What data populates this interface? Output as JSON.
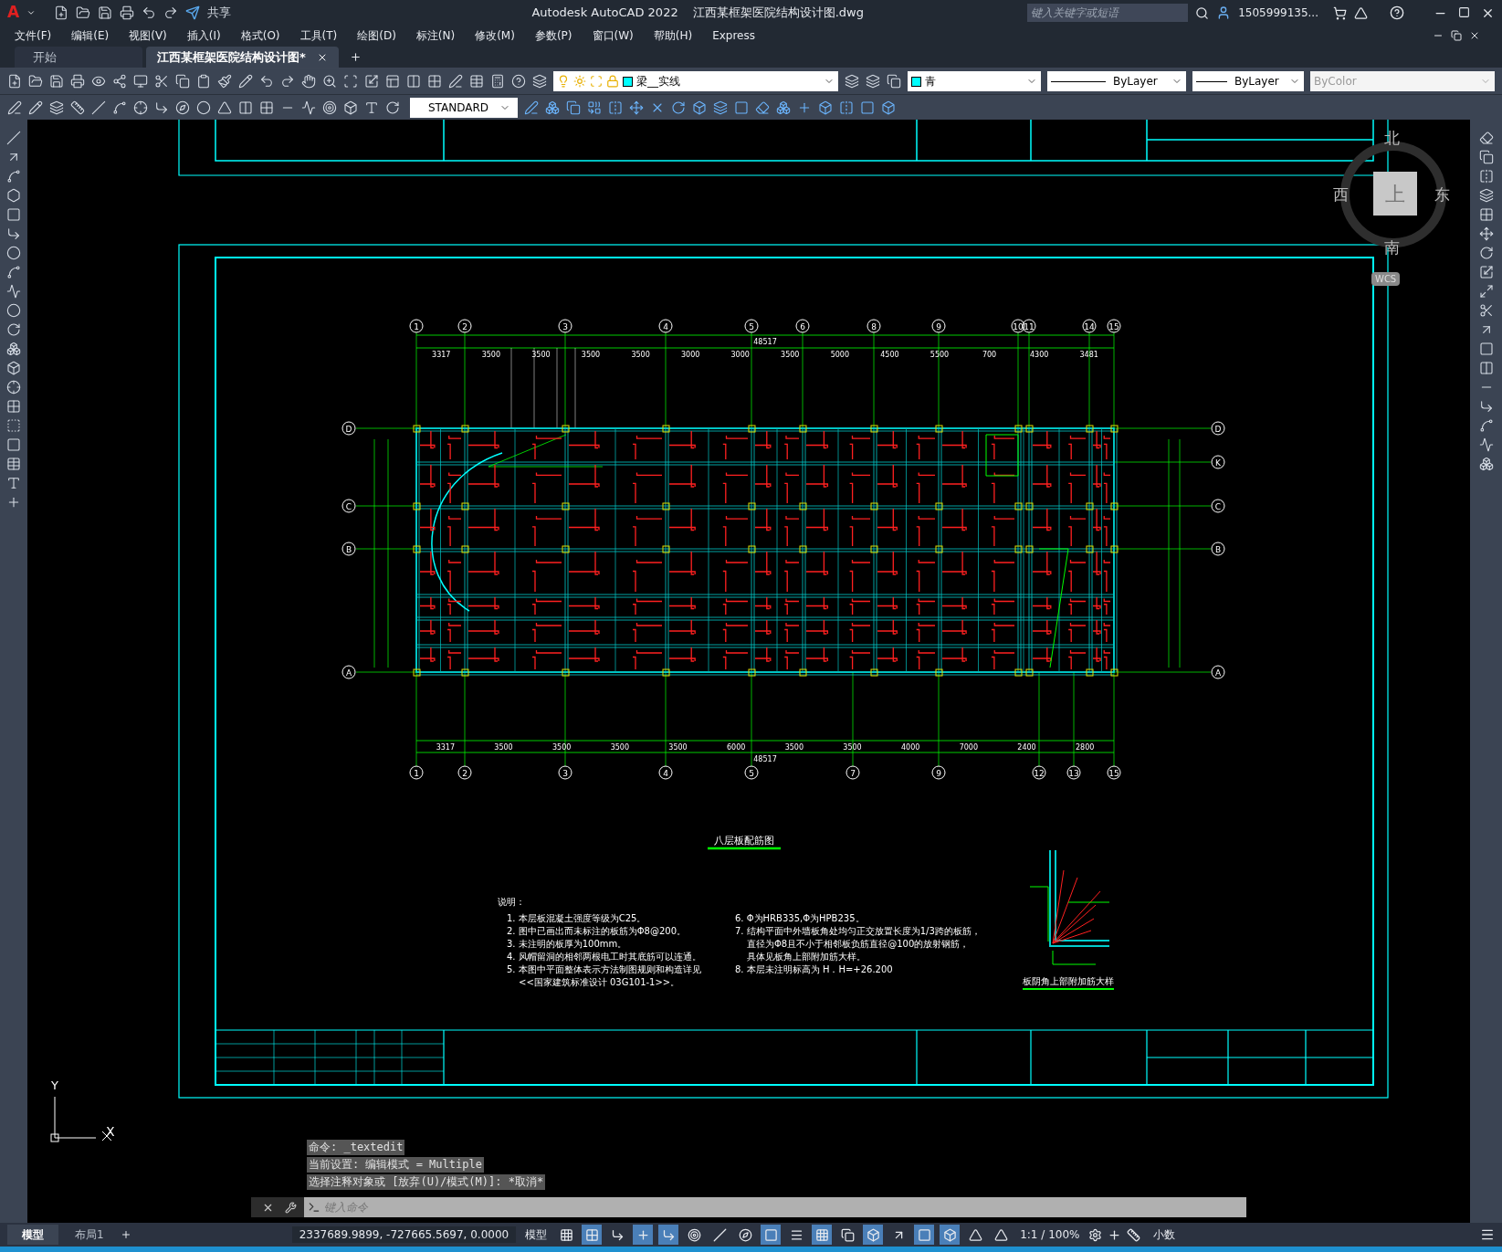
{
  "title_bar": {
    "logo": "A",
    "share": "共享",
    "app_title": "Autodesk AutoCAD 2022",
    "file_name": "江西某框架医院结构设计图.dwg",
    "search_placeholder": "键入关键字或短语",
    "user": "1505999135..."
  },
  "menu": [
    "文件(F)",
    "编辑(E)",
    "视图(V)",
    "插入(I)",
    "格式(O)",
    "工具(T)",
    "绘图(D)",
    "标注(N)",
    "修改(M)",
    "参数(P)",
    "窗口(W)",
    "帮助(H)",
    "Express"
  ],
  "doc_tabs": [
    {
      "label": "开始",
      "selected": false
    },
    {
      "label": "江西某框架医院结构设计图*",
      "selected": true
    }
  ],
  "toolbar": {
    "layer": "梁__实线",
    "color_name": "青",
    "color": "#00ffff",
    "linetype": "ByLayer",
    "lineweight": "ByLayer",
    "plot_style": "ByColor",
    "text_style": "STANDARD"
  },
  "viewcube": {
    "north": "北",
    "west": "西",
    "east": "东",
    "south": "南",
    "face": "上",
    "wcs": "WCS"
  },
  "ucs": {
    "x": "X",
    "y": "Y"
  },
  "drawing": {
    "top_axes": [
      "1",
      "2",
      "3",
      "4",
      "5",
      "6",
      "8",
      "9",
      "10",
      "11",
      "14",
      "15"
    ],
    "bottom_axes": [
      "1",
      "2",
      "3",
      "4",
      "5",
      "7",
      "9",
      "12",
      "13",
      "15"
    ],
    "left_axes": [
      "D",
      "C",
      "B",
      "A"
    ],
    "right_axes": [
      "D",
      "K",
      "C",
      "B",
      "A"
    ],
    "top_total": "48517",
    "top_dims": [
      "3317",
      "3500",
      "3500",
      "3500",
      "3500",
      "3000",
      "3000",
      "3500",
      "5000",
      "4500",
      "5500",
      "700",
      "4300",
      "3481"
    ],
    "bottom_dims": [
      "3317",
      "3500",
      "3500",
      "3500",
      "3500",
      "6000",
      "3500",
      "3500",
      "4000",
      "7000",
      "2400",
      "2800"
    ],
    "bottom_total": "48517",
    "title": "八层板配筋图",
    "notes_heading": "说明：",
    "notes_col1": [
      "1. 本层板混凝土强度等级为C25。",
      "2. 图中已画出而未标注的板筋为Φ8@200。",
      "3. 未注明的板厚为100mm。",
      "4. 风帽留洞的相邻两根电工时其底筋可以连通。",
      "5. 本图中平面整体表示方法制图规则和构造详见",
      "<<国家建筑标准设计 03G101-1>>。"
    ],
    "notes_col2": [
      "6. Φ为HRB335,Φ为HPB235。",
      "7. 结构平面中外墙板角处均匀正交放置长度为1/3跨的板筋，",
      "直径为Φ8且不小于相邻板负筋直径@100的放射钢筋，",
      "具体见板角上部附加筋大样。",
      "8. 本层未注明标高为 H．H=+26.200"
    ],
    "detail_caption": "板阴角上部附加筋大样"
  },
  "command_history": [
    "命令: _textedit",
    "当前设置: 编辑模式 = Multiple",
    "选择注释对象或 [放弃(U)/模式(M)]: *取消*"
  ],
  "command_placeholder": "键入命令",
  "layout_tabs": [
    {
      "label": "模型",
      "selected": true
    },
    {
      "label": "布局1",
      "selected": false
    }
  ],
  "status_bar": {
    "coordinates": "2337689.9899, -727665.5697, 0.0000",
    "space": "模型",
    "scale": "1:1 / 100%",
    "units": "小数",
    "toggles": [
      {
        "on": false
      },
      {
        "on": true
      },
      {
        "on": false
      },
      {
        "on": true
      },
      {
        "on": true
      },
      {
        "on": false
      },
      {
        "on": false
      },
      {
        "on": false
      },
      {
        "on": true
      },
      {
        "on": false
      },
      {
        "on": true
      },
      {
        "on": false
      },
      {
        "on": true
      },
      {
        "on": false
      },
      {
        "on": true
      },
      {
        "on": true
      },
      {
        "on": false
      },
      {
        "on": false
      }
    ]
  }
}
